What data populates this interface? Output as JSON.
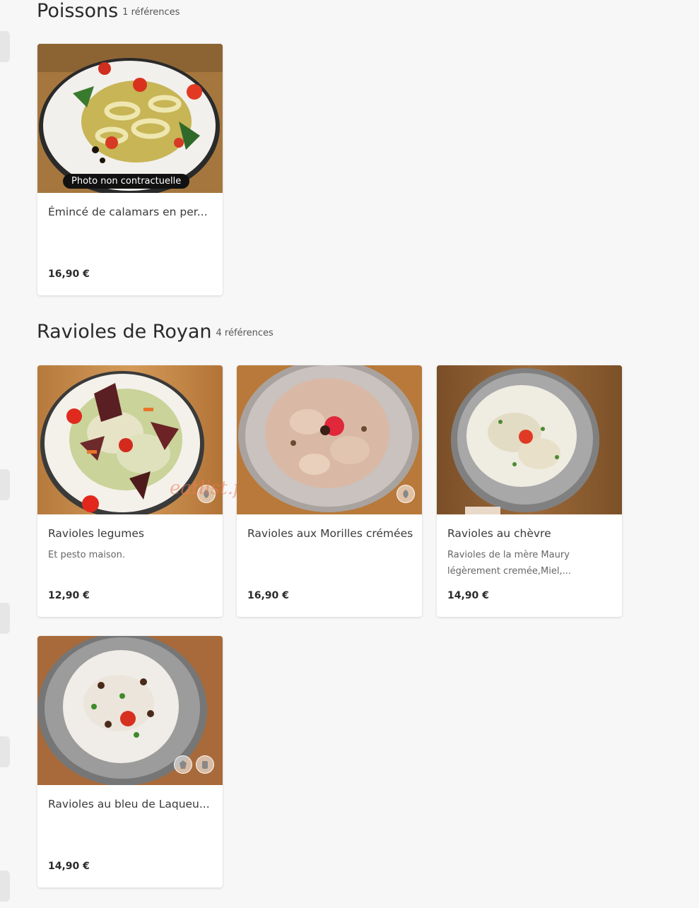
{
  "sections": [
    {
      "title": "Poissons",
      "count": "1 références",
      "items": [
        {
          "name": "Émincé de calamars en per...",
          "desc": "",
          "price": "16,90 €",
          "badge": "Photo non contractuelle"
        }
      ]
    },
    {
      "title": "Ravioles de Royan",
      "count": "4 références",
      "items": [
        {
          "name": "Ravioles legumes",
          "desc": "Et pesto maison.",
          "price": "12,90 €",
          "icon": "leaf-icon"
        },
        {
          "name": "Ravioles aux Morilles crémées",
          "desc": "",
          "price": "16,90 €",
          "icon": "leaf-icon"
        },
        {
          "name": "Ravioles au chèvre",
          "desc": "Ravioles de la mère Maury légèrement cremée,Miel,...",
          "price": "14,90 €"
        },
        {
          "name": "Ravioles au bleu de Laqueu...",
          "desc": "",
          "price": "14,90 €",
          "icons": [
            "nut-icon",
            "jar-icon"
          ]
        }
      ]
    }
  ],
  "watermark": "eatlist.fr",
  "colors": {
    "background": "#f7f7f7",
    "card": "#ffffff",
    "badge": "#111111"
  }
}
